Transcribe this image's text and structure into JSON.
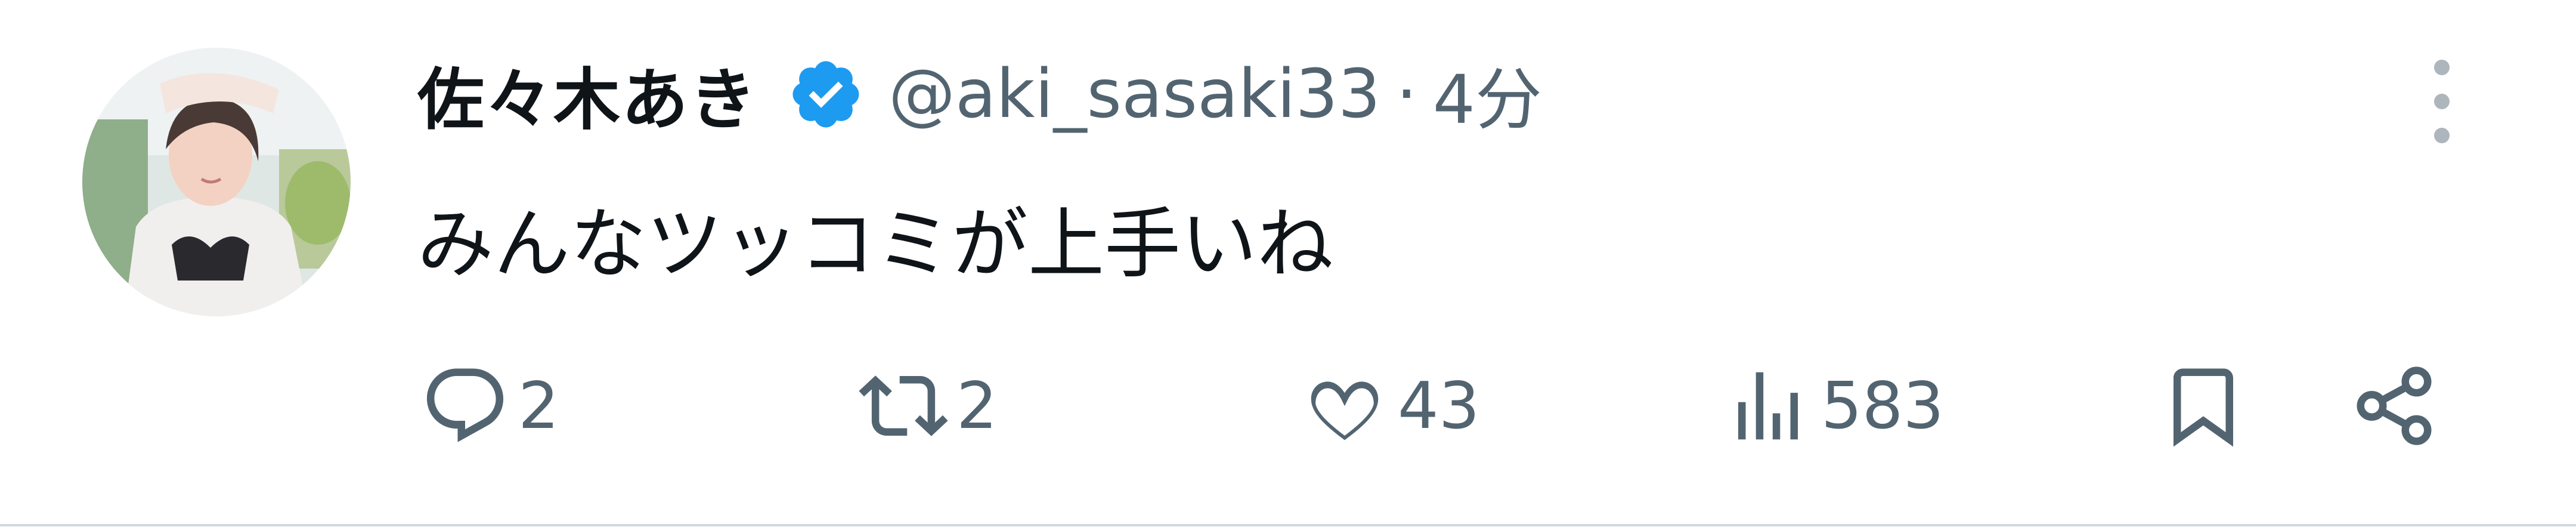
{
  "tweet": {
    "display_name": "佐々木あき",
    "handle": "@aki_sasaki33",
    "separator": "·",
    "time": "4分",
    "text": "みんなツッコミが上手いね"
  },
  "actions": {
    "replies": "2",
    "retweets": "2",
    "likes": "43",
    "views": "583"
  },
  "icons": [
    "verified-badge-icon",
    "more-icon",
    "reply-icon",
    "retweet-icon",
    "like-icon",
    "views-icon",
    "bookmark-icon",
    "share-icon"
  ],
  "colors": {
    "verified": "#1d9bf0",
    "text": "#0f1419",
    "secondary": "#536471",
    "divider": "#cfd9de"
  }
}
